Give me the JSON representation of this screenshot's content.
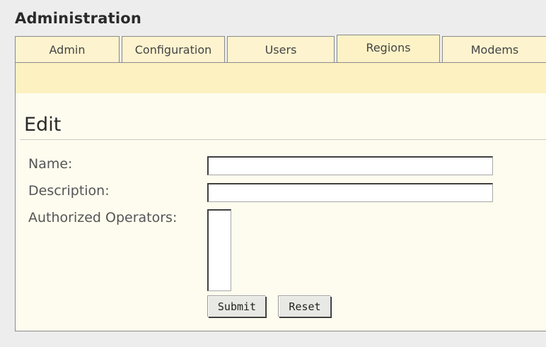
{
  "app": {
    "title": "Administration"
  },
  "tabs": [
    {
      "label": "Admin",
      "active": false
    },
    {
      "label": "Configuration",
      "active": false
    },
    {
      "label": "Users",
      "active": false
    },
    {
      "label": "Regions",
      "active": true
    },
    {
      "label": "Modems",
      "active": false
    }
  ],
  "form": {
    "heading": "Edit",
    "name_label": "Name:",
    "name_value": "",
    "description_label": "Description:",
    "description_value": "",
    "operators_label": "Authorized Operators:",
    "operators_options": [],
    "submit_label": "Submit",
    "reset_label": "Reset"
  },
  "colors": {
    "tab_bg": "#fdf3cf",
    "band_bg": "#fdf1c2",
    "panel_bg": "#fefcee",
    "page_bg": "#ededed"
  }
}
